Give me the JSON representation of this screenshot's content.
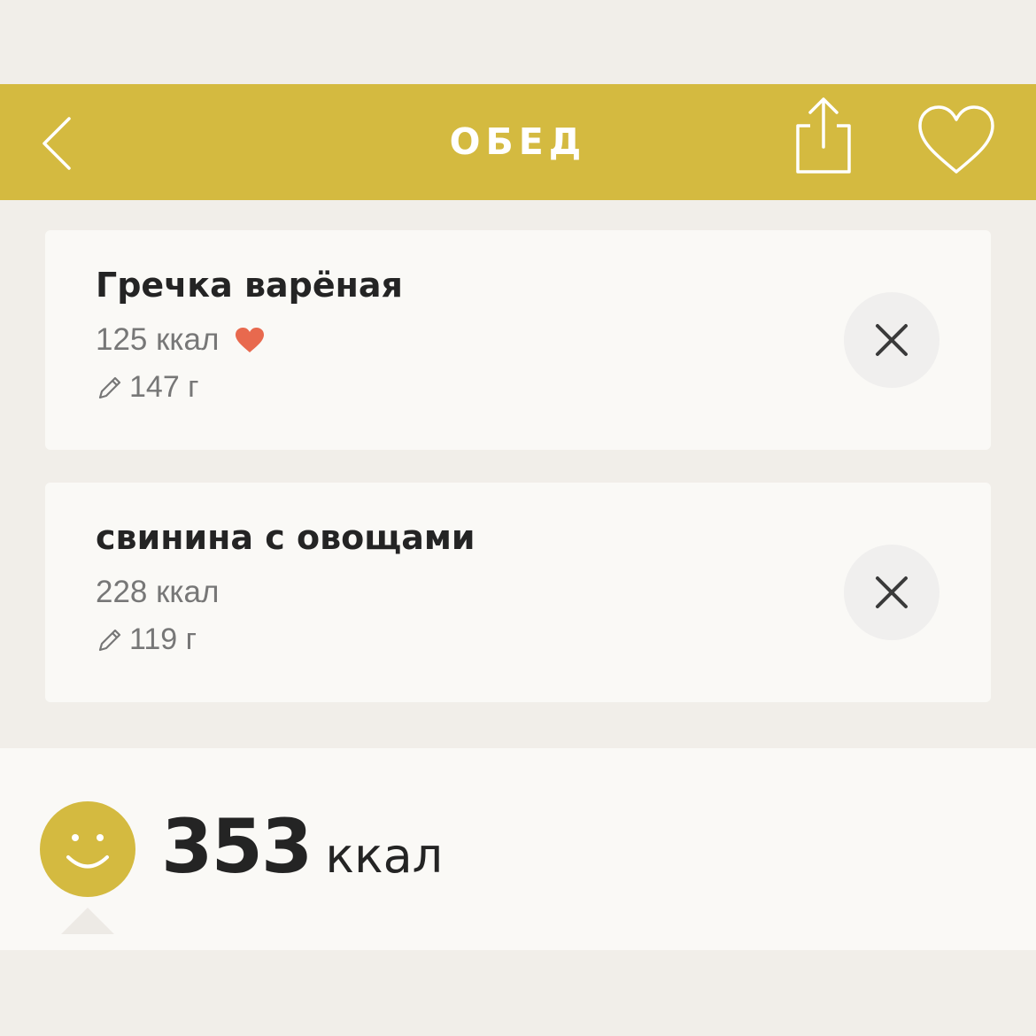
{
  "header": {
    "title": "ОБЕД",
    "back_icon": "chevron-left-icon",
    "share_icon": "share-icon",
    "favorite_icon": "heart-outline-icon",
    "background_color": "#D4BA40"
  },
  "items": [
    {
      "name": "Гречка варёная",
      "kcal": "125 ккал",
      "is_favorite": true,
      "weight": "147 г"
    },
    {
      "name": "свинина с овощами",
      "kcal": "228 ккал",
      "is_favorite": false,
      "weight": "119 г"
    }
  ],
  "footer": {
    "total_value": "353",
    "total_unit": "ккал",
    "status_icon": "smiley-icon"
  },
  "colors": {
    "accent": "#D4BA40",
    "favorite": "#E8694E",
    "background": "#F1EEE9",
    "card": "#FAF9F6"
  }
}
